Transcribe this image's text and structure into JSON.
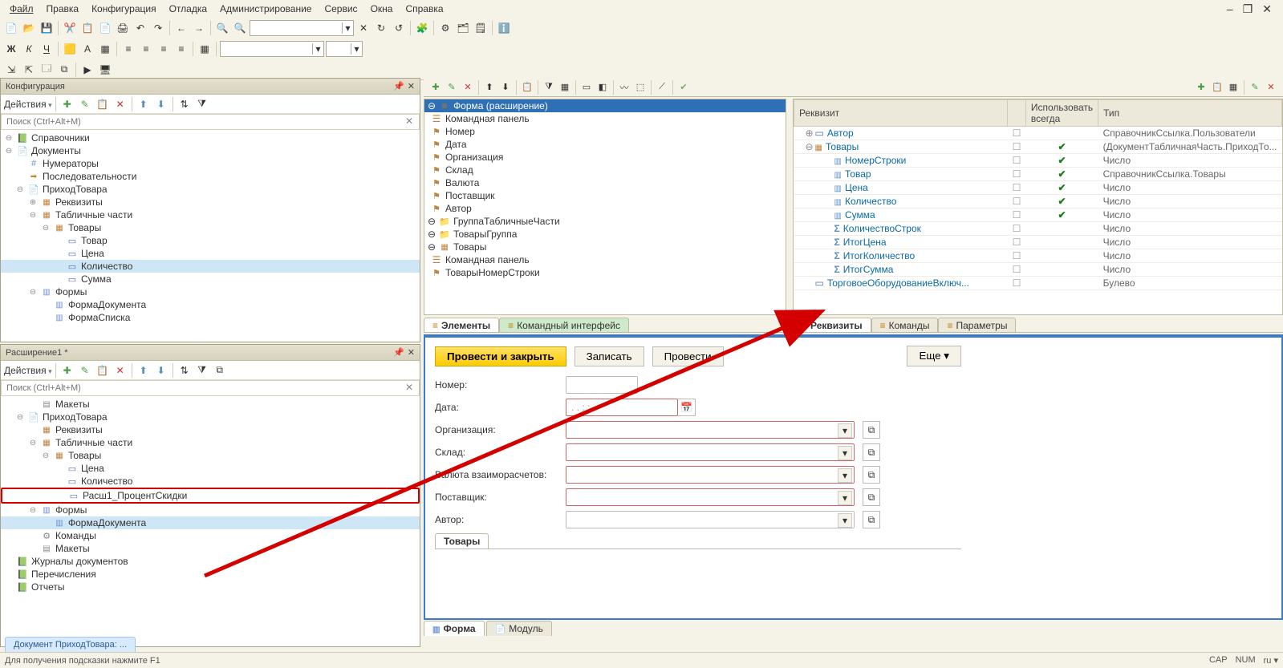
{
  "menu": [
    "Файл",
    "Правка",
    "Конфигурация",
    "Отладка",
    "Администрирование",
    "Сервис",
    "Окна",
    "Справка"
  ],
  "panels": {
    "config": {
      "title": "Конфигурация",
      "actions_label": "Действия",
      "search_placeholder": "Поиск (Ctrl+Alt+M)",
      "tree": [
        {
          "level": 0,
          "exp": "⊖",
          "icon": "book",
          "label": "Справочники"
        },
        {
          "level": 0,
          "exp": "⊖",
          "icon": "doc",
          "label": "Документы"
        },
        {
          "level": 1,
          "exp": "",
          "icon": "num",
          "label": "Нумераторы"
        },
        {
          "level": 1,
          "exp": "",
          "icon": "seq",
          "label": "Последовательности"
        },
        {
          "level": 1,
          "exp": "⊖",
          "icon": "doc",
          "label": "ПриходТовара"
        },
        {
          "level": 2,
          "exp": "⊕",
          "icon": "bar",
          "label": "Реквизиты"
        },
        {
          "level": 2,
          "exp": "⊖",
          "icon": "bar",
          "label": "Табличные части"
        },
        {
          "level": 3,
          "exp": "⊖",
          "icon": "bar",
          "label": "Товары"
        },
        {
          "level": 4,
          "exp": "",
          "icon": "rect",
          "label": "Товар"
        },
        {
          "level": 4,
          "exp": "",
          "icon": "rect",
          "label": "Цена"
        },
        {
          "level": 4,
          "exp": "",
          "icon": "rect",
          "label": "Количество",
          "sel": true
        },
        {
          "level": 4,
          "exp": "",
          "icon": "rect",
          "label": "Сумма"
        },
        {
          "level": 2,
          "exp": "⊖",
          "icon": "form",
          "label": "Формы"
        },
        {
          "level": 3,
          "exp": "",
          "icon": "form",
          "label": "ФормаДокумента"
        },
        {
          "level": 3,
          "exp": "",
          "icon": "form",
          "label": "ФормаСписка"
        }
      ]
    },
    "ext": {
      "title": "Расширение1 *",
      "actions_label": "Действия",
      "search_placeholder": "Поиск (Ctrl+Alt+M)",
      "tree": [
        {
          "level": 2,
          "exp": "",
          "icon": "tmpl",
          "label": "Макеты"
        },
        {
          "level": 1,
          "exp": "⊖",
          "icon": "doc",
          "label": "ПриходТовара"
        },
        {
          "level": 2,
          "exp": "",
          "icon": "bar",
          "label": "Реквизиты"
        },
        {
          "level": 2,
          "exp": "⊖",
          "icon": "bar",
          "label": "Табличные части"
        },
        {
          "level": 3,
          "exp": "⊖",
          "icon": "bar",
          "label": "Товары"
        },
        {
          "level": 4,
          "exp": "",
          "icon": "rect",
          "label": "Цена"
        },
        {
          "level": 4,
          "exp": "",
          "icon": "rect",
          "label": "Количество"
        },
        {
          "level": 4,
          "exp": "",
          "icon": "rect",
          "label": "Расш1_ПроцентСкидки",
          "highlight": true
        },
        {
          "level": 2,
          "exp": "⊖",
          "icon": "form",
          "label": "Формы"
        },
        {
          "level": 3,
          "exp": "",
          "icon": "form",
          "label": "ФормаДокумента",
          "sel": true
        },
        {
          "level": 2,
          "exp": "",
          "icon": "gear",
          "label": "Команды"
        },
        {
          "level": 2,
          "exp": "",
          "icon": "tmpl",
          "label": "Макеты"
        },
        {
          "level": 0,
          "exp": "",
          "icon": "book",
          "label": "Журналы документов"
        },
        {
          "level": 0,
          "exp": "",
          "icon": "book",
          "label": "Перечисления"
        },
        {
          "level": 0,
          "exp": "",
          "icon": "book",
          "label": "Отчеты"
        }
      ]
    }
  },
  "form_tree": {
    "root": "Форма (расширение)",
    "items": [
      {
        "level": 1,
        "icon": "panel",
        "label": "Командная панель"
      },
      {
        "level": 1,
        "icon": "flag",
        "label": "Номер"
      },
      {
        "level": 1,
        "icon": "flag",
        "label": "Дата"
      },
      {
        "level": 1,
        "icon": "flag",
        "label": "Организация"
      },
      {
        "level": 1,
        "icon": "flag",
        "label": "Склад"
      },
      {
        "level": 1,
        "icon": "flag",
        "label": "Валюта"
      },
      {
        "level": 1,
        "icon": "flag",
        "label": "Поставщик"
      },
      {
        "level": 1,
        "icon": "flag",
        "label": "Автор"
      },
      {
        "level": 1,
        "exp": "⊖",
        "icon": "folder",
        "label": "ГруппаТабличныеЧасти"
      },
      {
        "level": 2,
        "exp": "⊖",
        "icon": "folder",
        "label": "ТоварыГруппа"
      },
      {
        "level": 3,
        "exp": "⊖",
        "icon": "bar",
        "label": "Товары"
      },
      {
        "level": 4,
        "icon": "panel",
        "label": "Командная панель"
      },
      {
        "level": 4,
        "icon": "flag",
        "label": "ТоварыНомерСтроки"
      }
    ]
  },
  "attrs": {
    "headers": [
      "Реквизит",
      "",
      "Использовать всегда",
      "Тип"
    ],
    "rows": [
      {
        "level": 0,
        "exp": "⊕",
        "icon": "rect",
        "label": "Автор",
        "c1": "☐",
        "c2": "",
        "type": "СправочникСсылка.Пользователи"
      },
      {
        "level": 0,
        "exp": "⊖",
        "icon": "bar",
        "label": "Товары",
        "c1": "☐",
        "c2": "✔",
        "type": "(ДокументТабличнаяЧасть.ПриходТо..."
      },
      {
        "level": 1,
        "icon": "col",
        "label": "НомерСтроки",
        "c1": "☐",
        "c2": "✔",
        "type": "Число"
      },
      {
        "level": 1,
        "icon": "col",
        "label": "Товар",
        "c1": "☐",
        "c2": "✔",
        "type": "СправочникСсылка.Товары"
      },
      {
        "level": 1,
        "icon": "col",
        "label": "Цена",
        "c1": "☐",
        "c2": "✔",
        "type": "Число"
      },
      {
        "level": 1,
        "icon": "col",
        "label": "Количество",
        "c1": "☐",
        "c2": "✔",
        "type": "Число"
      },
      {
        "level": 1,
        "icon": "col",
        "label": "Сумма",
        "c1": "☐",
        "c2": "✔",
        "type": "Число"
      },
      {
        "level": 1,
        "icon": "sigma",
        "label": "КоличествоСтрок",
        "c1": "☐",
        "c2": "",
        "type": "Число"
      },
      {
        "level": 1,
        "icon": "sigma",
        "label": "ИтогЦена",
        "c1": "☐",
        "c2": "",
        "type": "Число"
      },
      {
        "level": 1,
        "icon": "sigma",
        "label": "ИтогКоличество",
        "c1": "☐",
        "c2": "",
        "type": "Число"
      },
      {
        "level": 1,
        "icon": "sigma",
        "label": "ИтогСумма",
        "c1": "☐",
        "c2": "",
        "type": "Число"
      },
      {
        "level": 0,
        "icon": "rect",
        "label": "ТорговоеОборудованиеВключ...",
        "c1": "☐",
        "c2": "",
        "type": "Булево"
      }
    ]
  },
  "tabs_left": [
    {
      "label": "Элементы",
      "icon": "stack",
      "active": true
    },
    {
      "label": "Командный интерфейс",
      "icon": "stack",
      "green": true
    }
  ],
  "tabs_right": [
    {
      "label": "Реквизиты",
      "icon": "stack",
      "active": true
    },
    {
      "label": "Команды",
      "icon": "stack"
    },
    {
      "label": "Параметры",
      "icon": "stack"
    }
  ],
  "form_preview": {
    "buttons": {
      "primary": "Провести и закрыть",
      "save": "Записать",
      "post": "Провести",
      "more": "Еще"
    },
    "fields": [
      {
        "label": "Номер:",
        "type": "text"
      },
      {
        "label": "Дата:",
        "type": "date",
        "value": " .  .      :  :"
      },
      {
        "label": "Организация:",
        "type": "ref"
      },
      {
        "label": "Склад:",
        "type": "ref"
      },
      {
        "label": "Валюта взаиморасчетов:",
        "type": "ref"
      },
      {
        "label": "Поставщик:",
        "type": "ref"
      },
      {
        "label": "Автор:",
        "type": "ref",
        "gray": true
      }
    ],
    "subtabs": [
      "Товары"
    ]
  },
  "bottom_tabs": [
    {
      "label": "Форма",
      "icon": "form",
      "active": true
    },
    {
      "label": "Модуль",
      "icon": "doc"
    }
  ],
  "doc_tab": "Документ ПриходТовара: ...",
  "status": {
    "hint": "Для получения подсказки нажмите F1",
    "cap": "CAP",
    "num": "NUM",
    "lang": "ru ▾"
  }
}
